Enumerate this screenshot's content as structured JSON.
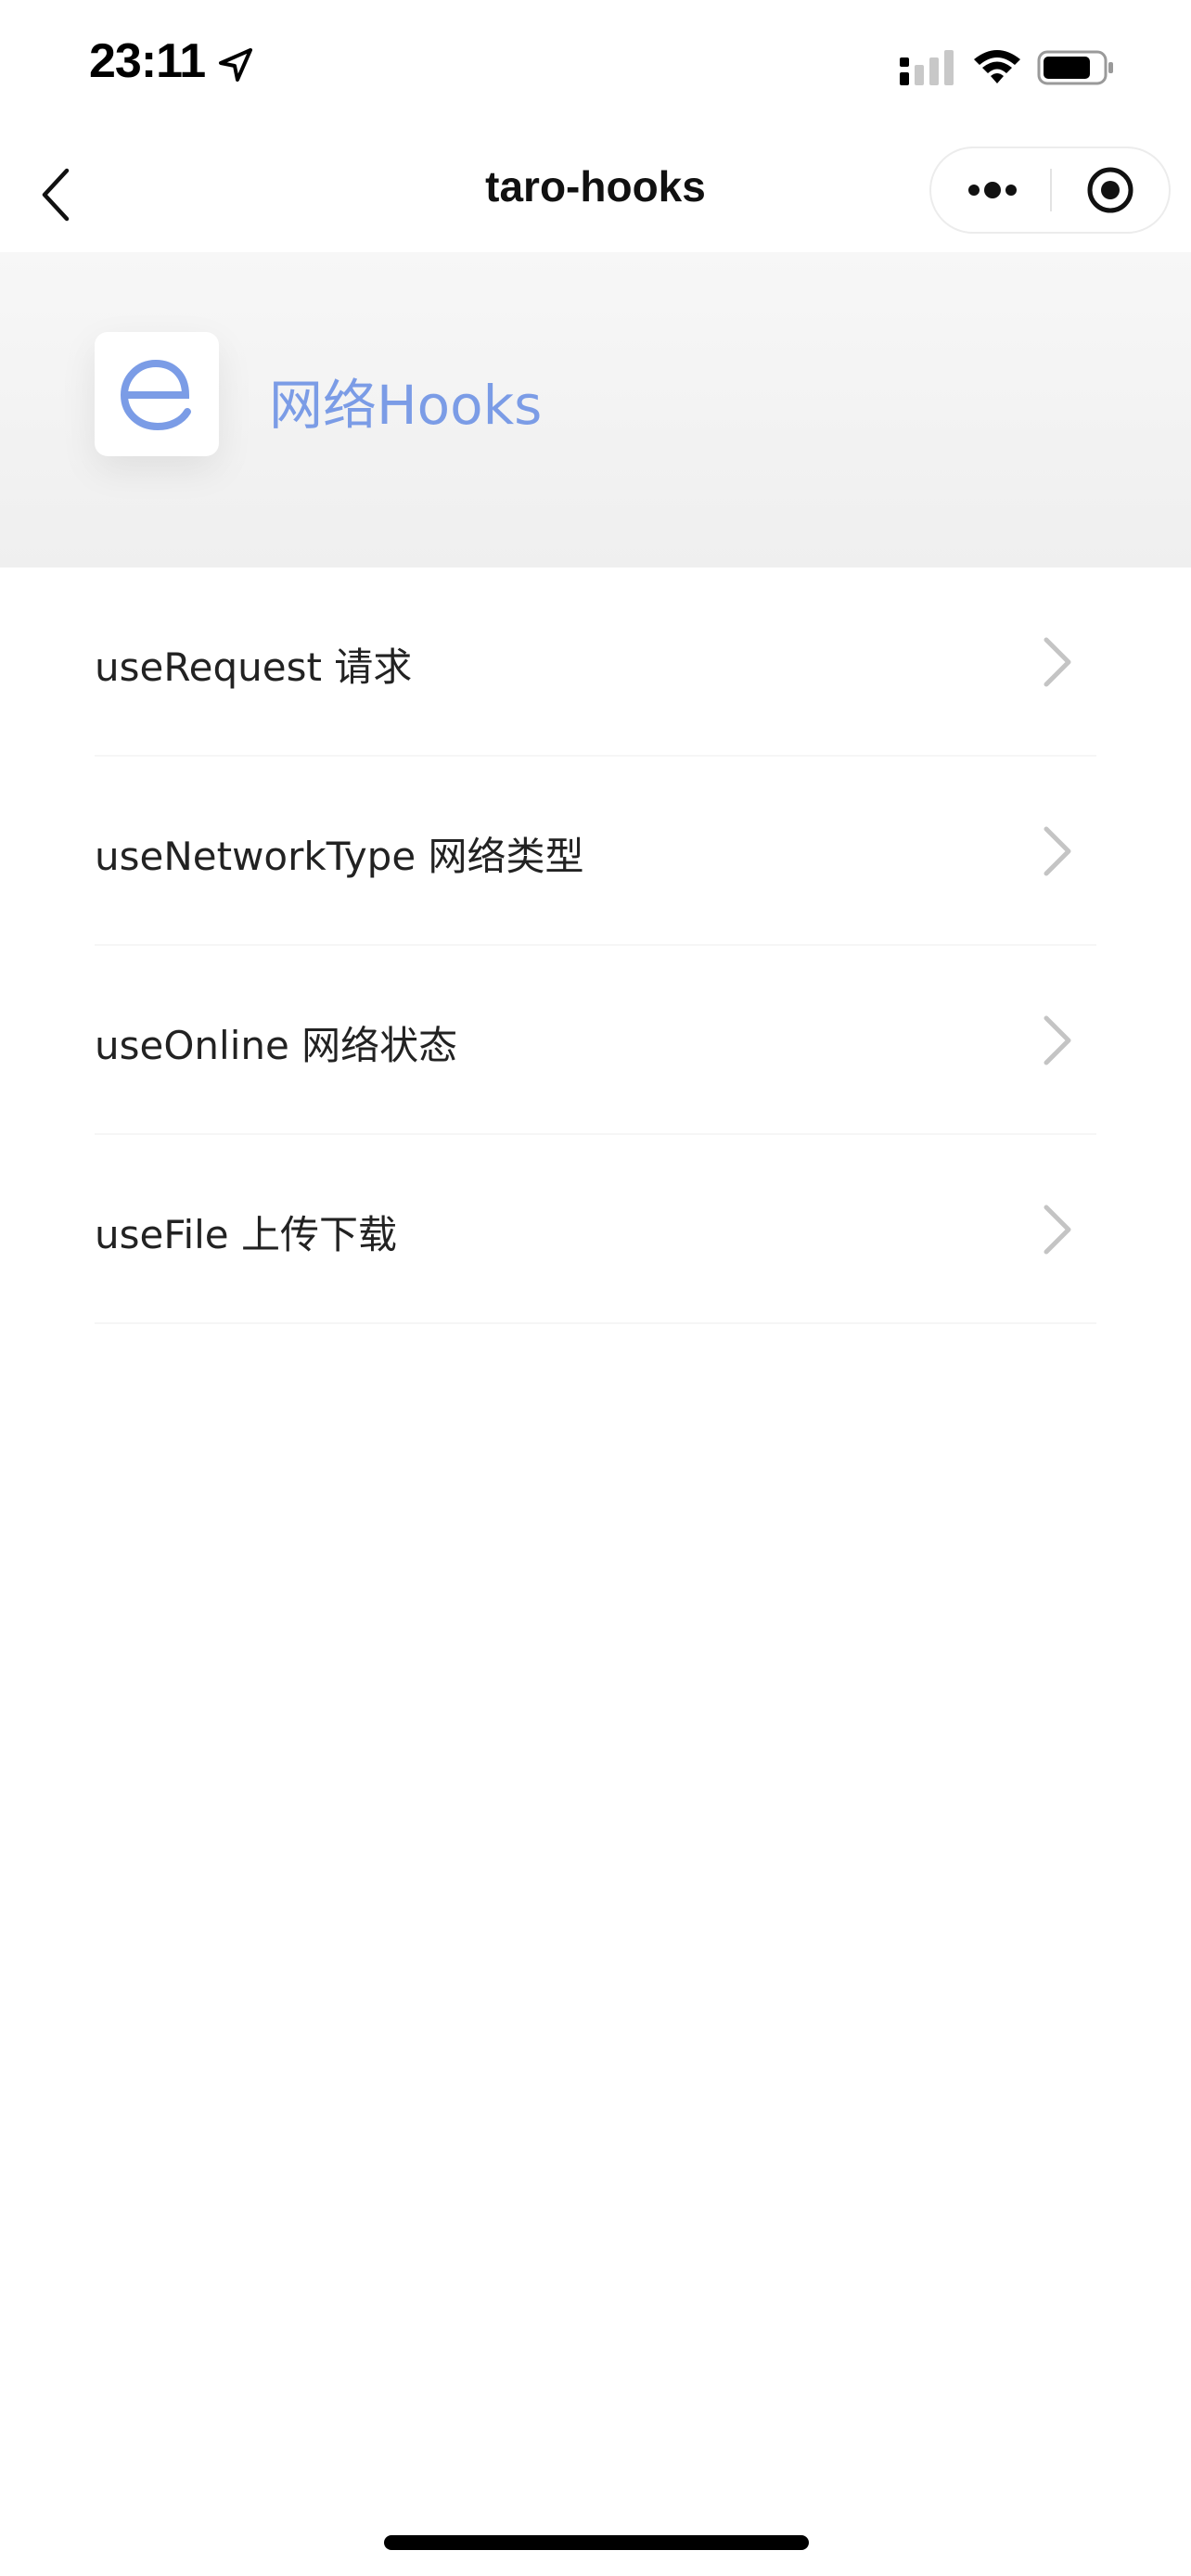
{
  "status_bar": {
    "time": "23:11"
  },
  "nav": {
    "title": "taro-hooks"
  },
  "header": {
    "title": "网络Hooks",
    "accent_color": "#7b9ce6"
  },
  "menu": {
    "items": [
      {
        "label": "useRequest 请求"
      },
      {
        "label": "useNetworkType 网络类型"
      },
      {
        "label": "useOnline 网络状态"
      },
      {
        "label": "useFile 上传下载"
      }
    ]
  },
  "icons": {
    "status": [
      "location-arrow-icon",
      "cellular-signal-icon",
      "wifi-icon",
      "battery-icon"
    ],
    "nav": [
      "back-chevron-icon",
      "more-dots-icon",
      "close-target-icon"
    ],
    "logo": "e-logo-icon",
    "list": "chevron-right-icon"
  }
}
